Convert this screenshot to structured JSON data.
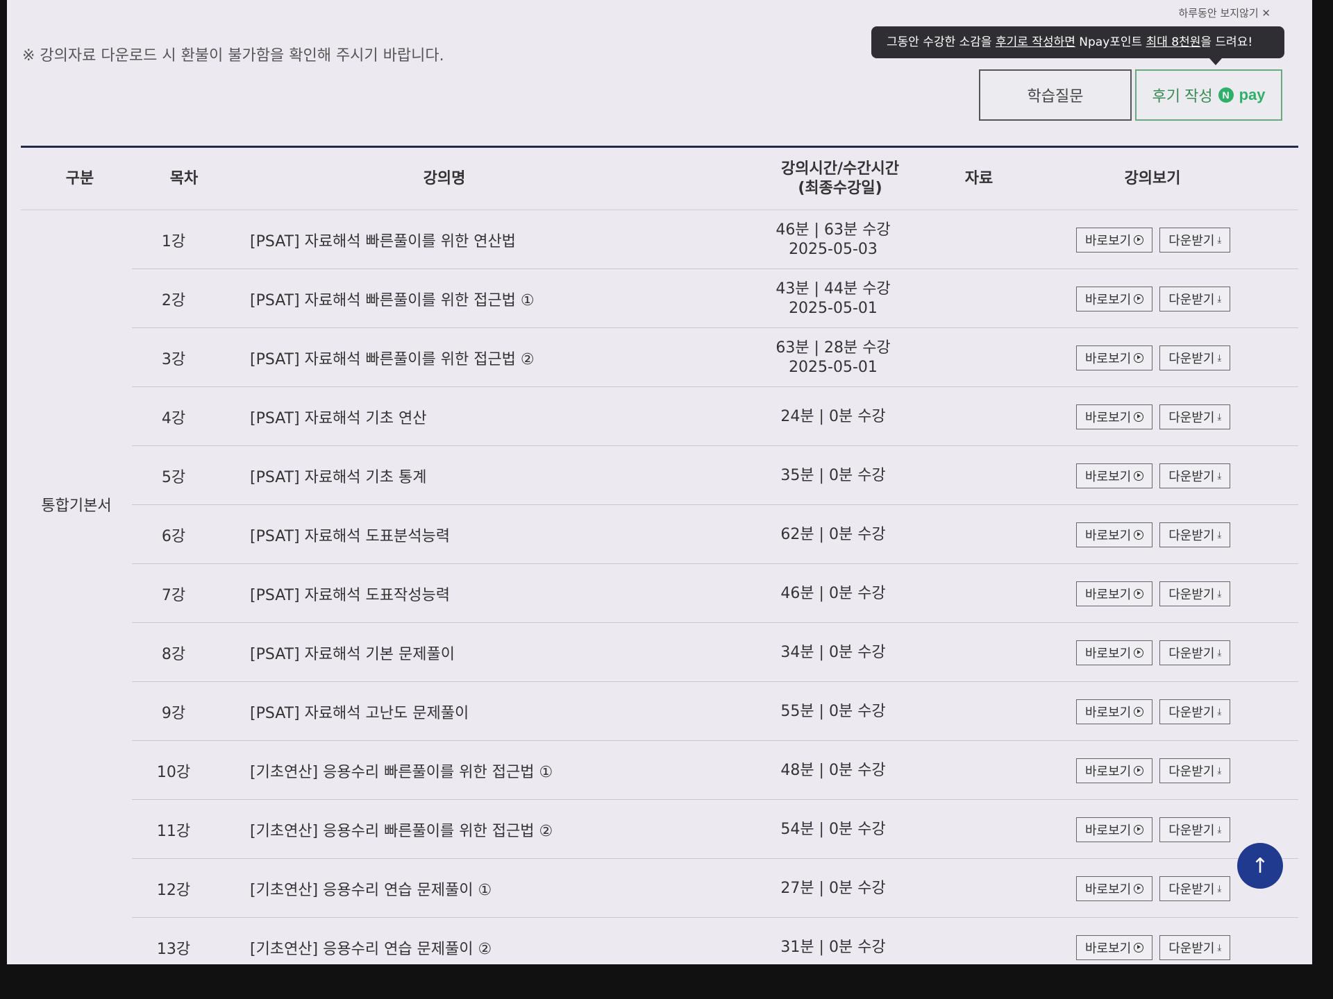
{
  "top": {
    "hide_today": "하루동안 보지않기 ✕",
    "notice": "※ 강의자료 다운로드 시 환불이 불가함을 확인해 주시기 바랍니다.",
    "tooltip": {
      "pre": "그동안 수강한 소감을 ",
      "u1": "후기로 작성하면",
      "mid": " Npay포인트 ",
      "u2": "최대 8천원",
      "post": "을 드려요!"
    },
    "qna_label": "학습질문",
    "review_label": "후기 작성",
    "npay_n": "N",
    "npay_text": "pay"
  },
  "table": {
    "headers": {
      "gubun": "구분",
      "mokcha": "목차",
      "name": "강의명",
      "time_l1": "강의시간/수간시간",
      "time_l2": "(최종수강일)",
      "data": "자료",
      "view": "강의보기"
    },
    "category": "통합기본서",
    "view_label": "바로보기",
    "download_label": "다운받기",
    "rows": [
      {
        "num": "1강",
        "title": "[PSAT] 자료해석 빠른풀이를 위한 연산법",
        "time": "46분 | 63분 수강",
        "date": "2025-05-03"
      },
      {
        "num": "2강",
        "title": "[PSAT] 자료해석 빠른풀이를 위한 접근법 ①",
        "time": "43분 | 44분 수강",
        "date": "2025-05-01"
      },
      {
        "num": "3강",
        "title": "[PSAT] 자료해석 빠른풀이를 위한 접근법 ②",
        "time": "63분 | 28분 수강",
        "date": "2025-05-01"
      },
      {
        "num": "4강",
        "title": "[PSAT] 자료해석 기초 연산",
        "time": "24분 | 0분 수강",
        "date": ""
      },
      {
        "num": "5강",
        "title": "[PSAT] 자료해석 기초 통계",
        "time": "35분 | 0분 수강",
        "date": ""
      },
      {
        "num": "6강",
        "title": "[PSAT] 자료해석 도표분석능력",
        "time": "62분 | 0분 수강",
        "date": ""
      },
      {
        "num": "7강",
        "title": "[PSAT] 자료해석 도표작성능력",
        "time": "46분 | 0분 수강",
        "date": ""
      },
      {
        "num": "8강",
        "title": "[PSAT] 자료해석 기본 문제풀이",
        "time": "34분 | 0분 수강",
        "date": ""
      },
      {
        "num": "9강",
        "title": "[PSAT] 자료해석 고난도 문제풀이",
        "time": "55분 | 0분 수강",
        "date": ""
      },
      {
        "num": "10강",
        "title": "[기초연산] 응용수리 빠른풀이를 위한 접근법 ①",
        "time": "48분 | 0분 수강",
        "date": ""
      },
      {
        "num": "11강",
        "title": "[기초연산] 응용수리 빠른풀이를 위한 접근법 ②",
        "time": "54분 | 0분 수강",
        "date": ""
      },
      {
        "num": "12강",
        "title": "[기초연산] 응용수리 연습 문제풀이 ①",
        "time": "27분 | 0분 수강",
        "date": ""
      },
      {
        "num": "13강",
        "title": "[기초연산] 응용수리 연습 문제풀이 ②",
        "time": "31분 | 0분 수강",
        "date": ""
      }
    ]
  },
  "scroll_top_icon": "arrow-up-icon"
}
